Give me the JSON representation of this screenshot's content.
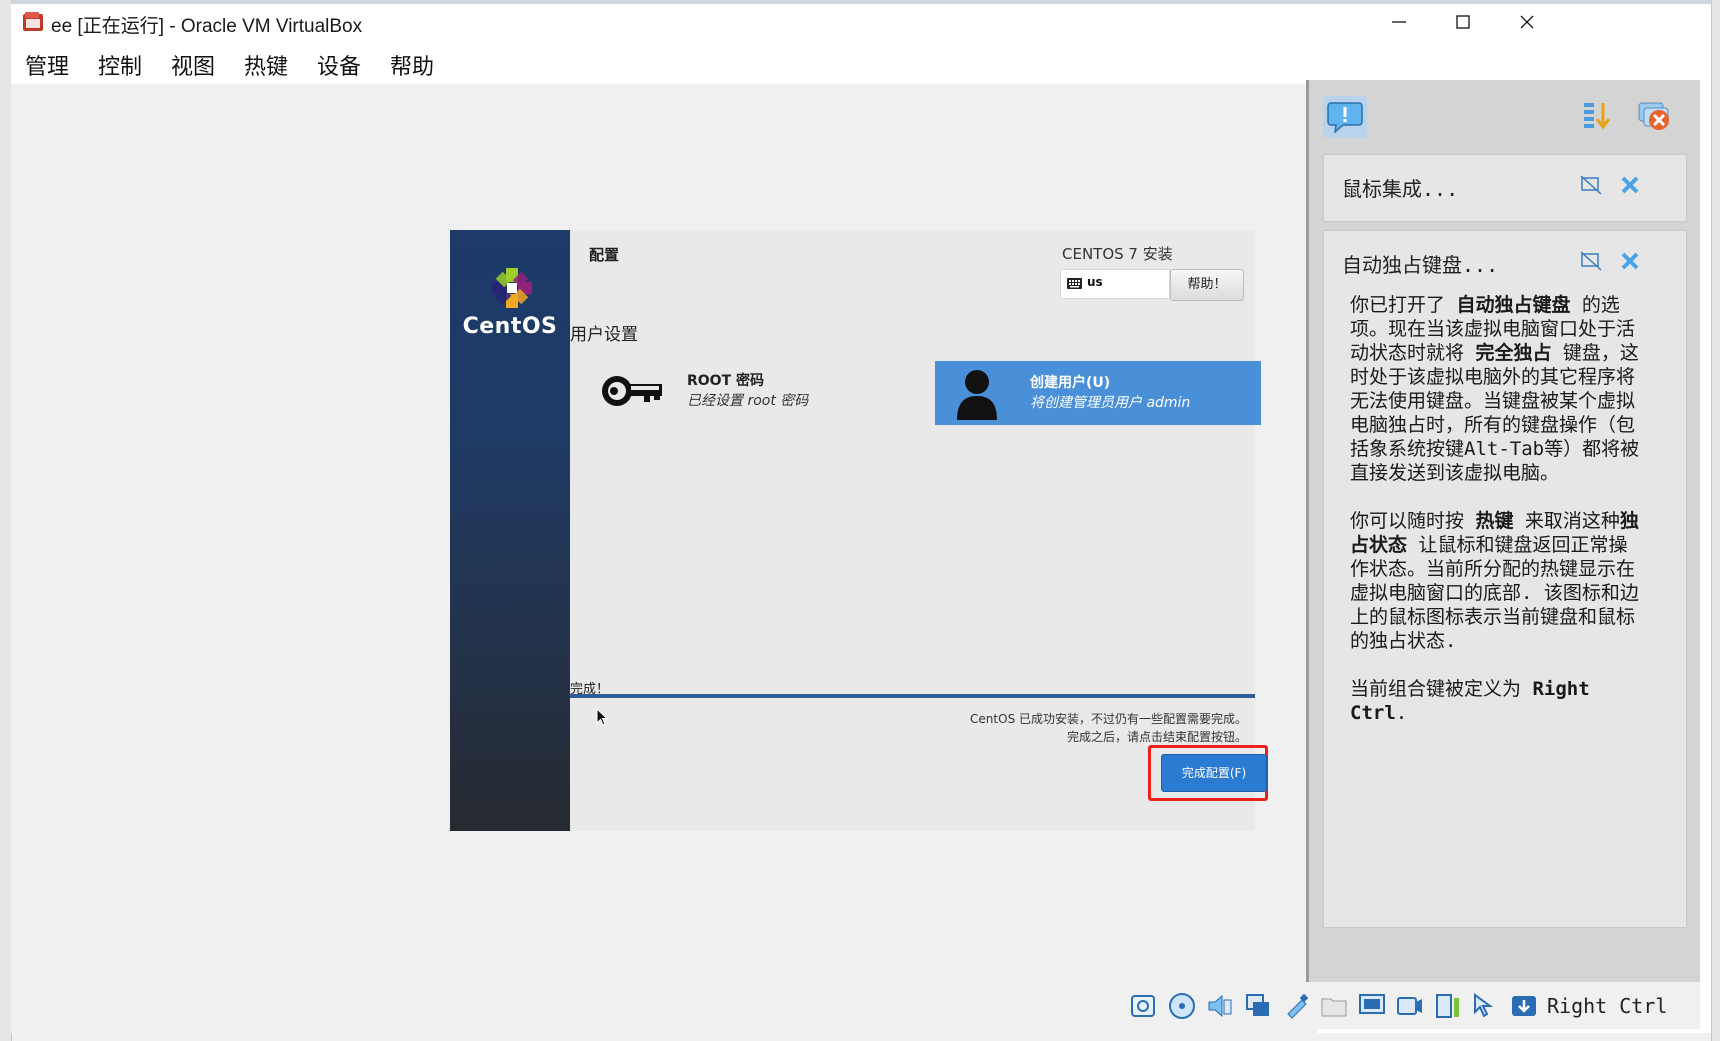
{
  "window": {
    "title": "ee [正在运行] - Oracle VM VirtualBox",
    "app_icon": "virtualbox-icon",
    "controls": [
      "minimize-icon",
      "maximize-icon",
      "close-icon"
    ]
  },
  "menubar": {
    "items": [
      "管理",
      "控制",
      "视图",
      "热键",
      "设备",
      "帮助"
    ]
  },
  "centos": {
    "brand": "CentOS",
    "section_title": "配置",
    "install_title": "CENTOS 7 安装",
    "keyboard_layout": "us",
    "help_button": "帮助！",
    "user_settings_heading": "用户设置",
    "root": {
      "title": "ROOT 密码",
      "subtitle": "已经设置 root 密码"
    },
    "create_user": {
      "title": "创建用户(U)",
      "subtitle": "将创建管理员用户 admin"
    },
    "done_label": "完成！",
    "message_line1": "CentOS 已成功安装，不过仍有一些配置需要完成。",
    "message_line2": "完成之后，请点击结束配置按钮。",
    "finish_button": "完成配置(F)",
    "progress": 1.0
  },
  "notifications": {
    "card1": {
      "title": "鼠标集成..."
    },
    "card2": {
      "title": "自动独占键盘...",
      "p1_a": "你已打开了 ",
      "p1_b": "自动独占键盘",
      "p1_c": " 的选项。现在当该虚拟电脑窗口处于活动状态时就将 ",
      "p1_d": "完全独占",
      "p1_e": " 键盘，这时处于该虚拟电脑外的其它程序将无法使用键盘。当键盘被某个虚拟电脑独占时，所有的键盘操作（包括象系统按键Alt-Tab等）都将被直接发送到该虚拟电脑。",
      "p2_a": "你可以随时按 ",
      "p2_b": "热键",
      "p2_c": " 来取消这种",
      "p2_d": "独占状态",
      "p2_e": " 让鼠标和键盘返回正常操作状态。当前所分配的热键显示在虚拟电脑窗口的底部. 该图标和边上的鼠标图标表示当前键盘和鼠标的独占状态.",
      "p3_a": "当前组合键被定义为 ",
      "p3_b": "Right Ctrl",
      "p3_c": "."
    }
  },
  "statusbar": {
    "icons": [
      "hard-disk-icon",
      "optical-disk-icon",
      "audio-icon",
      "network-icon",
      "usb-icon",
      "shared-folder-icon",
      "display-icon",
      "video-capture-icon",
      "cpu-icon",
      "mouse-capture-icon",
      "keyboard-capture-icon"
    ],
    "hotkey": "Right Ctrl"
  }
}
